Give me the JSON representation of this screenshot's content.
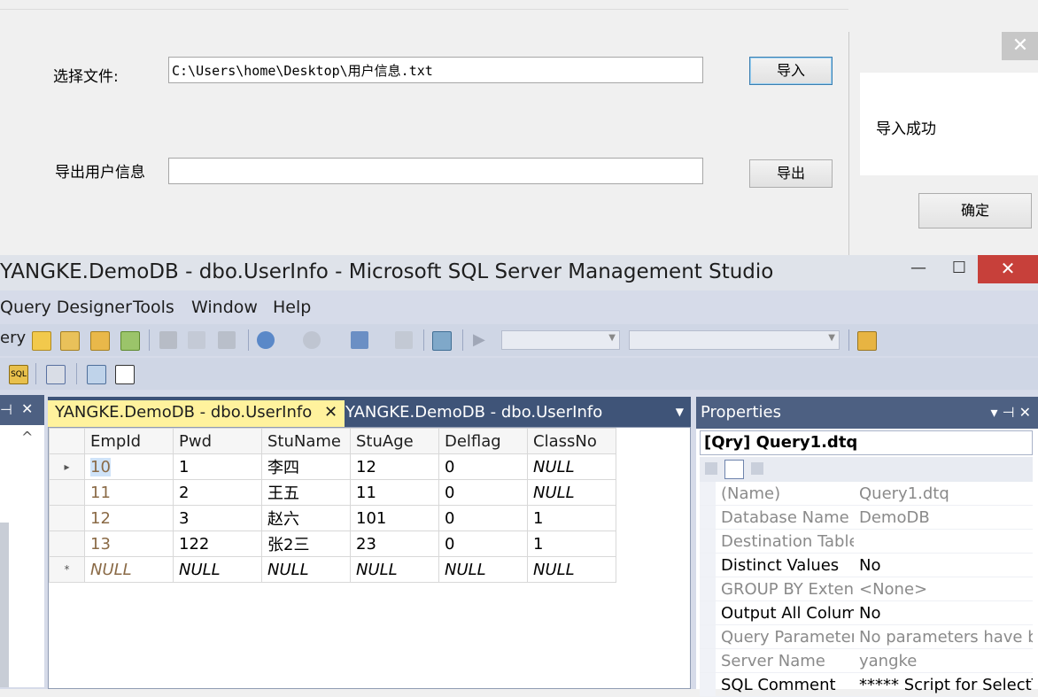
{
  "form": {
    "select_file_label": "选择文件:",
    "file_path_value": "C:\\Users\\home\\Desktop\\用户信息.txt",
    "import_button": "导入",
    "export_label": "导出用户信息",
    "export_value": "",
    "export_button": "导出"
  },
  "msgbox": {
    "close_glyph": "✕",
    "message": "导入成功",
    "ok_button": "确定"
  },
  "ssms": {
    "title": "YANGKE.DemoDB - dbo.UserInfo - Microsoft SQL Server Management Studio",
    "window_buttons": {
      "minimize": "—",
      "maximize": "☐",
      "close": "✕"
    },
    "menu": [
      "Query Designer",
      "Tools",
      "Window",
      "Help"
    ],
    "menu_partial": "Query",
    "toolbar_partial_label": "ery",
    "tabs": {
      "active": "YANGKE.DemoDB - dbo.UserInfo",
      "active_close": "✕",
      "inactive": "YANGKE.DemoDB - dbo.UserInfo",
      "dropdown": "▼"
    },
    "left_panel": {
      "pin": "⊣",
      "close": "✕",
      "scroll_up": "^"
    },
    "grid": {
      "columns": [
        "EmpId",
        "Pwd",
        "StuName",
        "StuAge",
        "Delflag",
        "ClassNo"
      ],
      "rows": [
        [
          "10",
          "1",
          "李四",
          "12",
          "0",
          "NULL"
        ],
        [
          "11",
          "2",
          "王五",
          "11",
          "0",
          "NULL"
        ],
        [
          "12",
          "3",
          "赵六",
          "101",
          "0",
          "1"
        ],
        [
          "13",
          "122",
          "张2三",
          "23",
          "0",
          "1"
        ],
        [
          "NULL",
          "NULL",
          "NULL",
          "NULL",
          "NULL",
          "NULL"
        ]
      ],
      "row_markers": [
        "▸",
        "",
        "",
        "",
        "*"
      ]
    },
    "properties": {
      "title": "Properties",
      "header_icons": "▾ ⊣ ✕",
      "object": "[Qry] Query1.dtq",
      "rows": [
        {
          "name": "(Name)",
          "value": "Query1.dtq",
          "readonly": true
        },
        {
          "name": "Database Name",
          "value": "DemoDB",
          "readonly": true
        },
        {
          "name": "Destination Table",
          "value": "",
          "readonly": true
        },
        {
          "name": "Distinct Values",
          "value": "No",
          "readonly": false
        },
        {
          "name": "GROUP BY Extens",
          "value": "<None>",
          "readonly": true
        },
        {
          "name": "Output All Colum",
          "value": "No",
          "readonly": false
        },
        {
          "name": "Query Parameter",
          "value": "No parameters have b",
          "readonly": true
        },
        {
          "name": "Server Name",
          "value": "yangke",
          "readonly": true
        },
        {
          "name": "SQL Comment",
          "value": "***** Script for SelectT",
          "readonly": false
        }
      ]
    },
    "accent_colors": {
      "panel_header": "#4d6082",
      "active_tab": "#fff29d",
      "close_red": "#c7403a"
    }
  }
}
